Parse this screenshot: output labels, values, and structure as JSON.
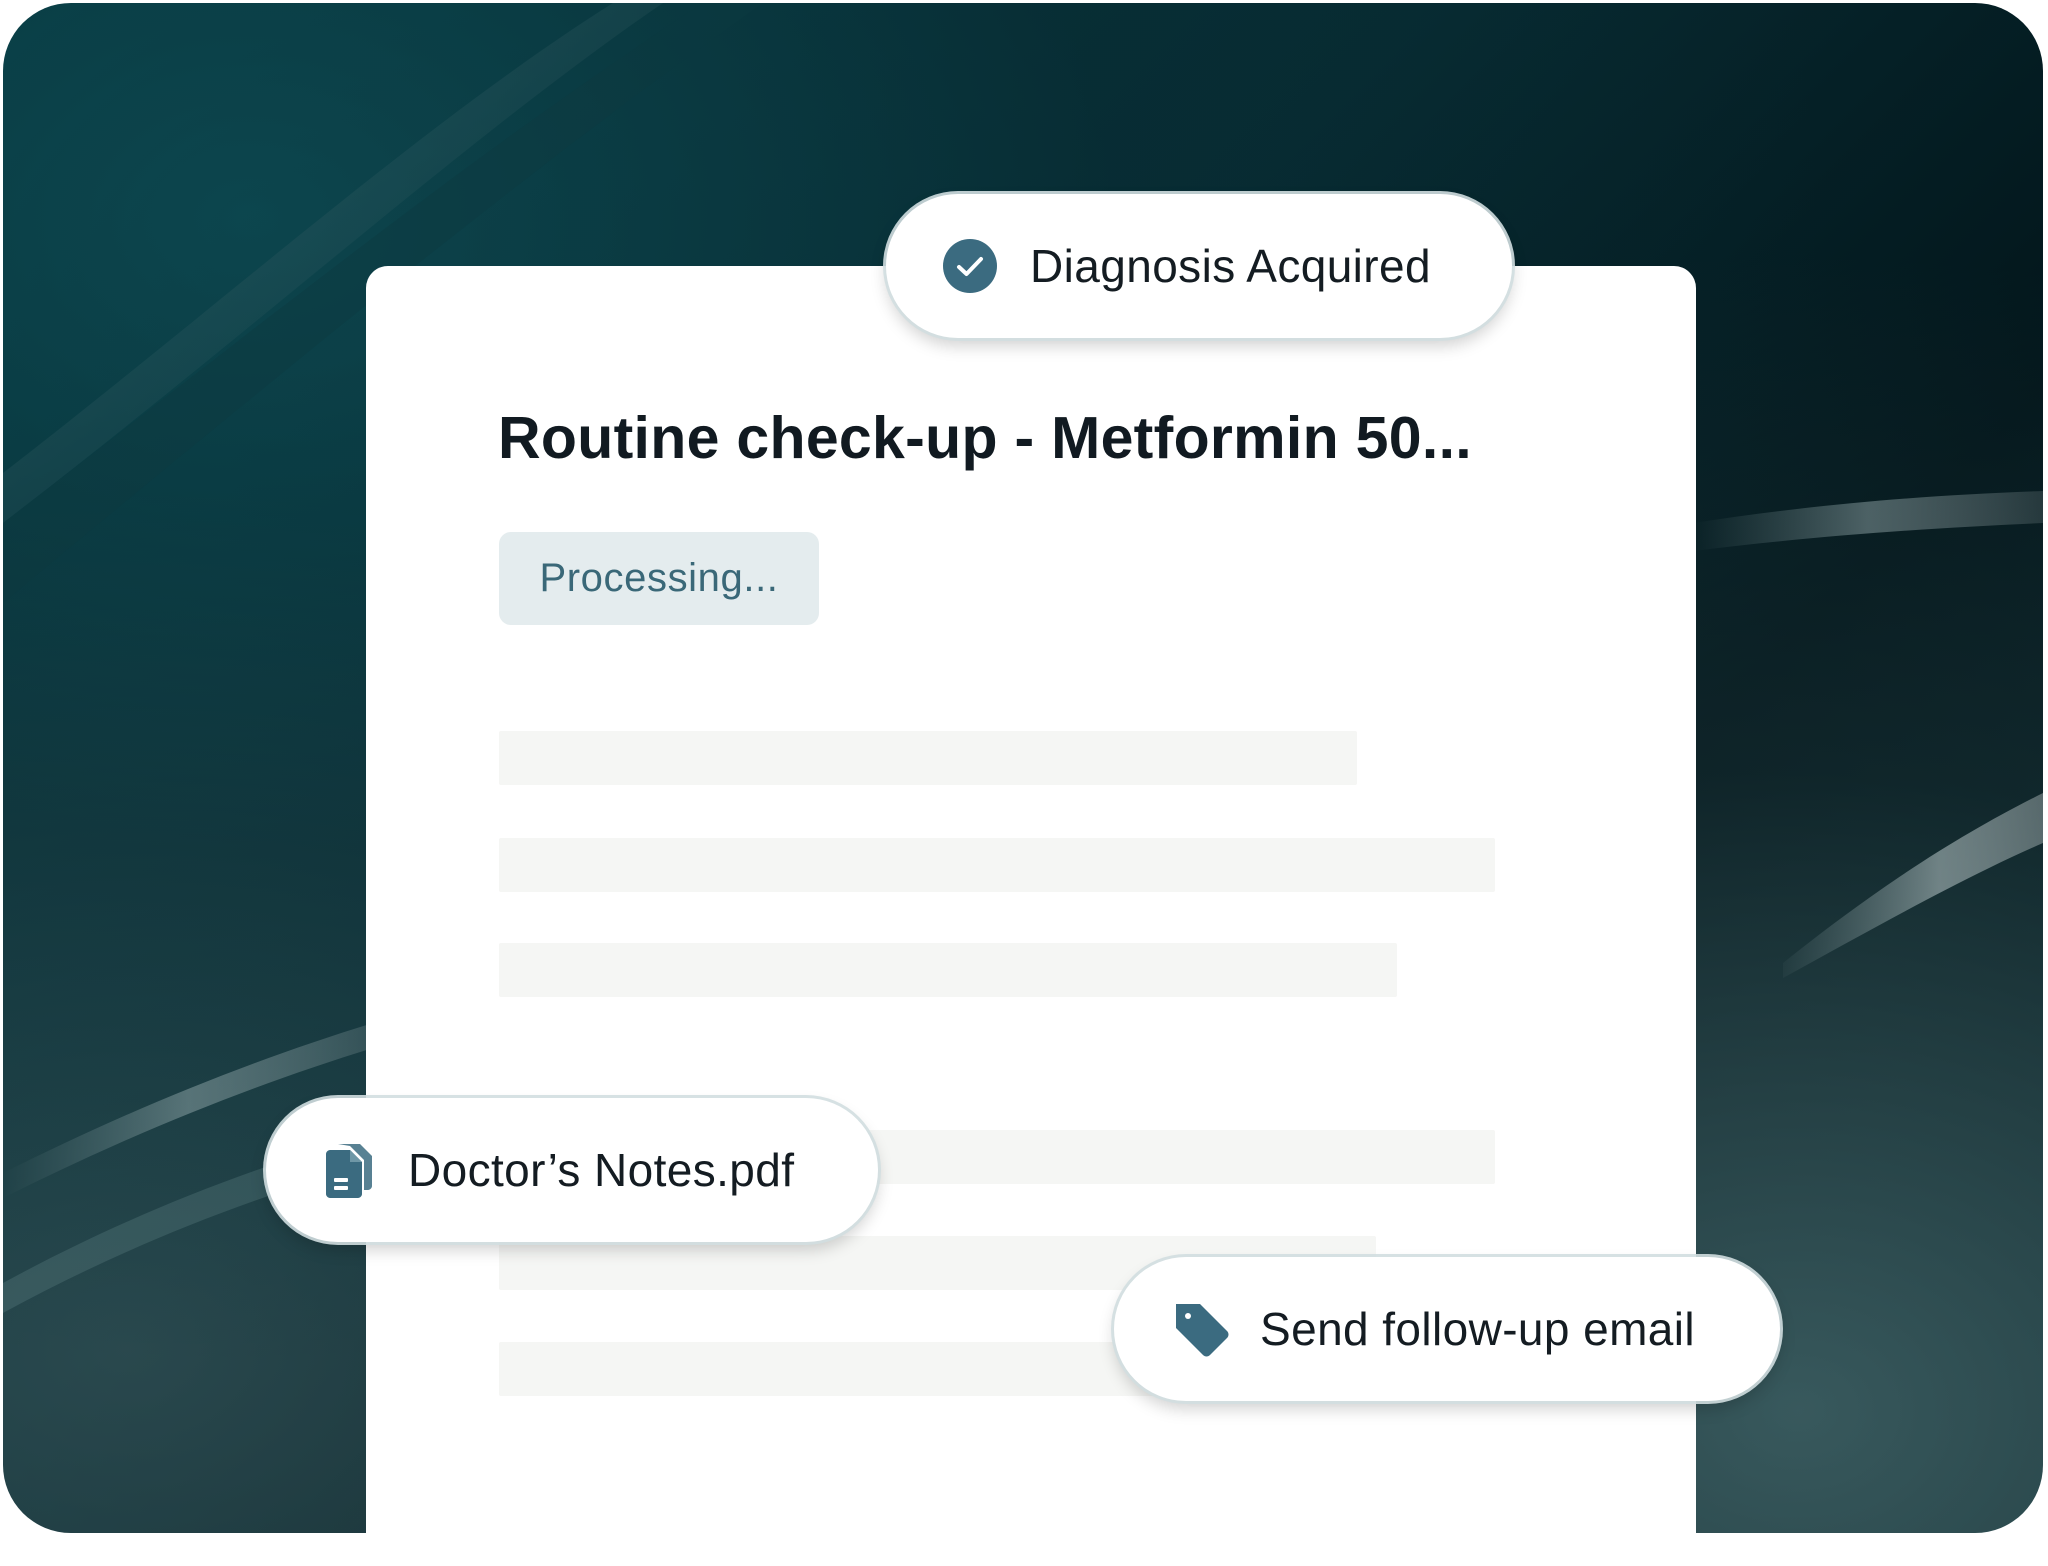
{
  "colors": {
    "accent": "#3b6b80",
    "badge_bg": "#e4ecee",
    "badge_text": "#3a6878",
    "title_text": "#111a21",
    "skeleton": "#f5f6f4",
    "background_dark": "#072a31"
  },
  "status_pill": {
    "label": "Diagnosis Acquired",
    "icon": "check-circle-icon"
  },
  "document_card": {
    "title": "Routine check-up - Metformin 50...",
    "status_badge": "Processing..."
  },
  "attachment_pill": {
    "label": "Doctor’s Notes.pdf",
    "icon": "document-icon"
  },
  "action_pill": {
    "label": "Send follow-up email",
    "icon": "tag-icon"
  }
}
